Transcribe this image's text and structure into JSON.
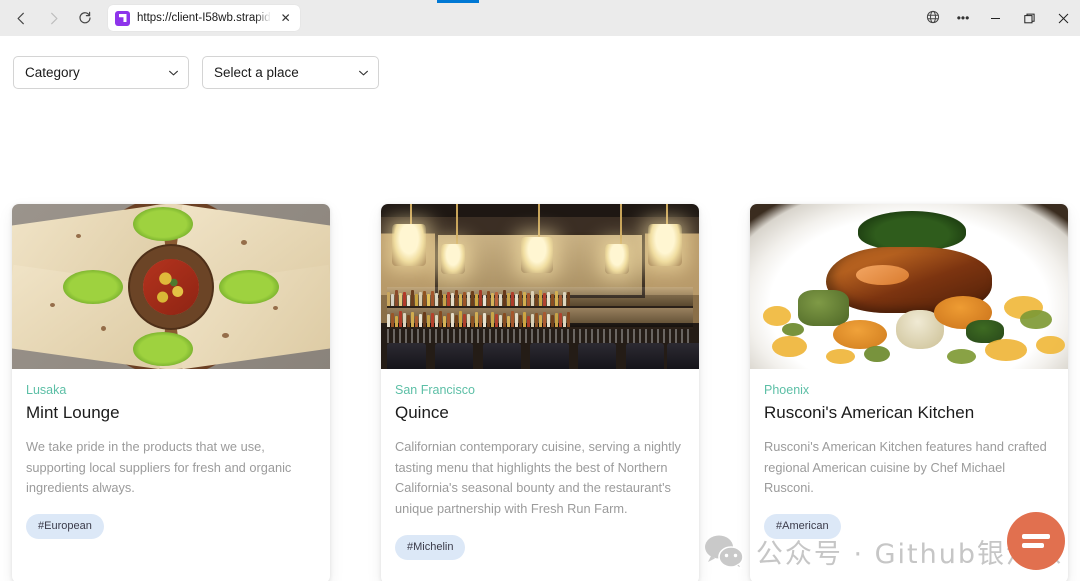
{
  "browser": {
    "back_icon": "back-arrow-icon",
    "forward_icon": "forward-arrow-icon",
    "reload_icon": "reload-icon",
    "tab": {
      "title": "https://client-I58wb.strapid",
      "favicon": "strapi-favicon",
      "close_label": "✕"
    },
    "controls": {
      "globe_icon": "globe-icon",
      "more_label": "•••",
      "minimize_label": "—",
      "maximize_icon": "restore-icon",
      "close_label": "✕"
    }
  },
  "filters": {
    "category": {
      "label": "Category",
      "caret": "chevron-down-icon"
    },
    "place": {
      "label": "Select a place",
      "caret": "chevron-down-icon"
    }
  },
  "cards": [
    {
      "place": "Lusaka",
      "title": "Mint Lounge",
      "description": "We take pride in the products that we use, supporting local suppliers for fresh and organic ingredients always.",
      "tag": "#European",
      "image_alt": "quesadilla-platter-photo"
    },
    {
      "place": "San Francisco",
      "title": "Quince",
      "description": "Californian contemporary cuisine, serving a nightly tasting menu that highlights the best of Northern California's seasonal bounty and the restaurant's unique partnership with Fresh Run Farm.",
      "tag": "#Michelin",
      "image_alt": "restaurant-bar-interior-photo"
    },
    {
      "place": "Phoenix",
      "title": "Rusconi's American Kitchen",
      "description": "Rusconi's American Kitchen features hand crafted regional American cuisine by Chef Michael Rusconi.",
      "tag": "#American",
      "image_alt": "plated-glazed-fish-photo"
    }
  ],
  "watermark": {
    "icon": "wechat-icon",
    "text": "公众号 · Github银河系"
  },
  "fab": {
    "icon": "menu-bars-icon"
  },
  "colors": {
    "accent_teal": "#5cbfa6",
    "tag_bg": "#dce8f7",
    "tab_indicator": "#0078d4",
    "fab_bg": "#e1704f",
    "chrome_bg": "#ebebeb"
  }
}
